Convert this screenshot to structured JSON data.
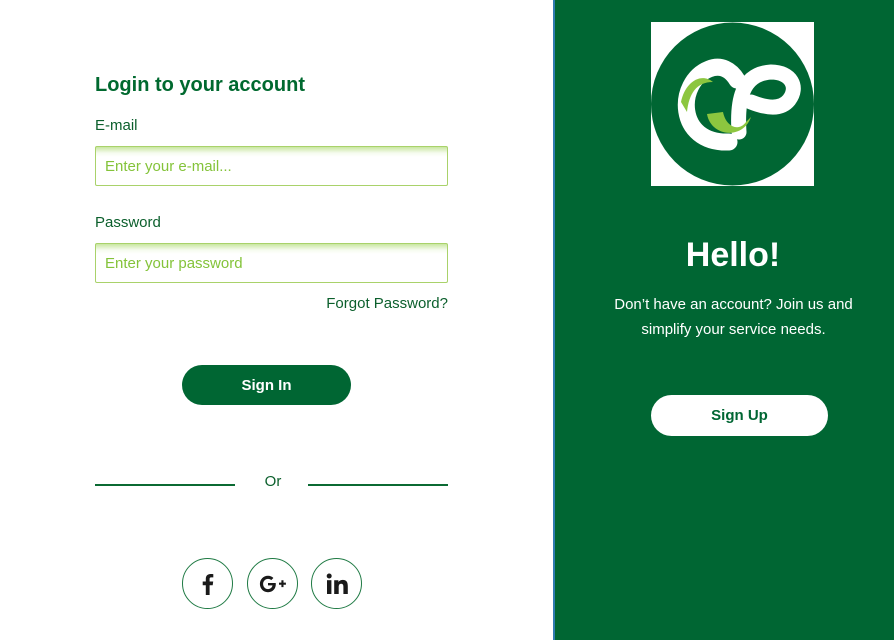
{
  "login": {
    "title": "Login to your account",
    "email_label": "E-mail",
    "email_placeholder": "Enter your e-mail...",
    "email_value": "",
    "password_label": "Password",
    "password_placeholder": "Enter your password",
    "password_value": "",
    "forgot_link": "Forgot Password?",
    "signin_label": "Sign In",
    "or_text": "Or"
  },
  "social": {
    "icons": [
      "facebook-icon",
      "google-plus-icon",
      "linkedin-icon"
    ]
  },
  "promo": {
    "logo_icon": "cp-logo-icon",
    "title": "Hello!",
    "message": "Don’t have an account? Join us and simplify your service needs.",
    "signup_label": "Sign Up"
  },
  "colors": {
    "brand_dark_green": "#006633",
    "accent_light_green": "#84c33a",
    "text_green": "#0b5f2c",
    "divider_blue": "#2f7bb0"
  }
}
